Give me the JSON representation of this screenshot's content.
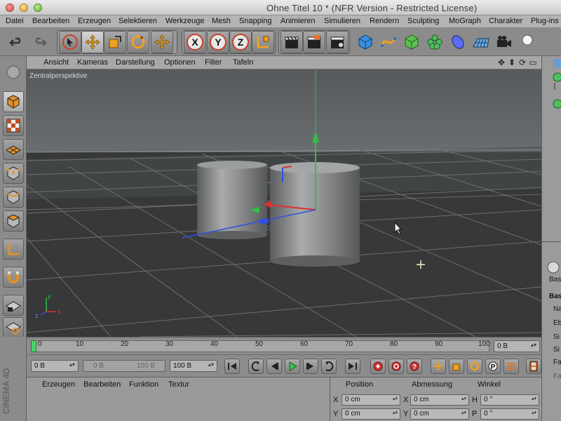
{
  "window": {
    "title": "Ohne Titel 10 * (NFR Version - Restricted License)"
  },
  "menubar": {
    "items": [
      "Datei",
      "Bearbeiten",
      "Erzeugen",
      "Selektieren",
      "Werkzeuge",
      "Mesh",
      "Snapping",
      "Animieren",
      "Simulieren",
      "Rendern",
      "Sculpting",
      "MoGraph",
      "Charakter",
      "Plug-ins"
    ]
  },
  "toolbar": {
    "axis_x_label": "X",
    "axis_y_label": "Y",
    "axis_z_label": "Z"
  },
  "viewport": {
    "menu": [
      "Ansicht",
      "Kameras",
      "Darstellung",
      "Optionen",
      "Filter",
      "Tafeln"
    ],
    "view_label": "Zentralperspektive",
    "axis_x": "x",
    "axis_y": "y",
    "axis_z": "z"
  },
  "timeline": {
    "ticks": [
      "0",
      "10",
      "20",
      "30",
      "40",
      "50",
      "60",
      "70",
      "80",
      "90",
      "100"
    ],
    "current_frame_field": "0 B",
    "start_field": "0 B",
    "range_min": "0 B",
    "range_max": "100 B",
    "end_field": "100 B"
  },
  "materials": {
    "menu": [
      "Erzeugen",
      "Bearbeiten",
      "Funktion",
      "Textur"
    ]
  },
  "coordinates": {
    "headers": [
      "Position",
      "Abmessung",
      "Winkel"
    ],
    "rows": [
      {
        "pos_label": "X",
        "pos_value": "0 cm",
        "size_label": "X",
        "size_value": "0 cm",
        "rot_label": "H",
        "rot_value": "0 °"
      },
      {
        "pos_label": "Y",
        "pos_value": "0 cm",
        "size_label": "Y",
        "size_value": "0 cm",
        "rot_label": "P",
        "rot_value": "0 °"
      }
    ]
  },
  "right_panel": {
    "tab_label": "Bas",
    "basic_label": "Basi",
    "rows": [
      "Na",
      "Eb",
      "Si",
      "Si",
      "Fa",
      "Fa"
    ]
  },
  "brand": {
    "text": "CINEMA 4D"
  },
  "colors": {
    "viewport_bg": "#3d3f41",
    "grid": "#7a7a7a",
    "axis_x": "#e03030",
    "axis_y": "#30c040",
    "axis_z": "#3050e0",
    "playhead": "#4bd36a"
  }
}
